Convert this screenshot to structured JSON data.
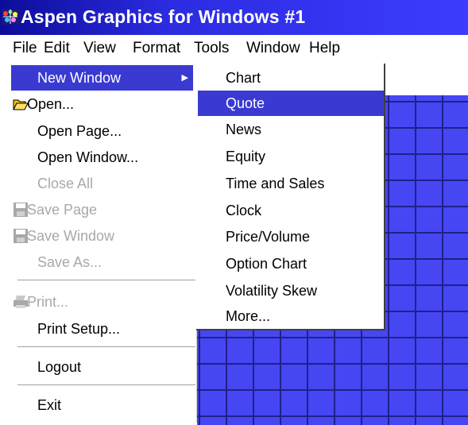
{
  "window": {
    "title": "Aspen Graphics for Windows #1",
    "app_icon": "aspen-app-icon"
  },
  "menubar": {
    "items": [
      "File",
      "Edit",
      "View",
      "Format",
      "Tools",
      "Window",
      "Help"
    ]
  },
  "file_menu": {
    "items": [
      {
        "label": "New Window",
        "state": "highlighted",
        "has_submenu": true
      },
      {
        "label": "Open...",
        "icon": "open-folder-icon",
        "state": "enabled"
      },
      {
        "label": "Open Page...",
        "state": "enabled"
      },
      {
        "label": "Open Window...",
        "state": "enabled"
      },
      {
        "label": "Close All",
        "state": "disabled"
      },
      {
        "label": "Save Page",
        "icon": "save-disk-icon",
        "state": "disabled"
      },
      {
        "label": "Save Window",
        "icon": "save-disk-icon",
        "state": "disabled"
      },
      {
        "label": "Save As...",
        "state": "disabled"
      },
      {
        "label": "Print...",
        "icon": "printer-icon",
        "state": "disabled"
      },
      {
        "label": "Print Setup...",
        "state": "enabled"
      },
      {
        "label": "Logout",
        "state": "enabled"
      },
      {
        "label": "Exit",
        "state": "enabled"
      }
    ]
  },
  "new_window_submenu": {
    "items": [
      {
        "label": "Chart",
        "state": "enabled"
      },
      {
        "label": "Quote",
        "state": "highlighted"
      },
      {
        "label": "News",
        "state": "enabled"
      },
      {
        "label": "Equity",
        "state": "enabled"
      },
      {
        "label": "Time and Sales",
        "state": "enabled"
      },
      {
        "label": "Clock",
        "state": "enabled"
      },
      {
        "label": "Price/Volume",
        "state": "enabled"
      },
      {
        "label": "Option Chart",
        "state": "enabled"
      },
      {
        "label": "Volatility Skew",
        "state": "enabled"
      },
      {
        "label": "More...",
        "state": "enabled"
      }
    ]
  },
  "colors": {
    "titlebar": "#2b2be0",
    "highlight": "#3a3ad2",
    "quote_grid": "#4646f2",
    "grid_lines": "#20208c",
    "disabled_text": "#a8a8a8"
  }
}
